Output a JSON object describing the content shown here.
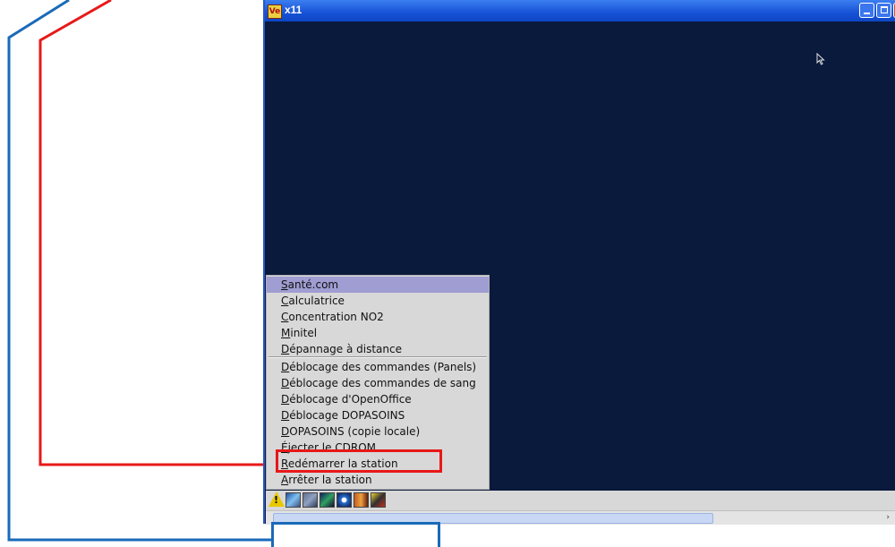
{
  "window": {
    "title": "x11",
    "app_icon_label": "Ve",
    "background_color": "#0a1a3c"
  },
  "menu": {
    "items": [
      {
        "prefix": "",
        "mnemonic": "S",
        "rest": "anté.com",
        "active": true
      },
      {
        "prefix": "",
        "mnemonic": "C",
        "rest": "alculatrice"
      },
      {
        "prefix": "",
        "mnemonic": "C",
        "rest": "oncentration NO2"
      },
      {
        "prefix": "",
        "mnemonic": "M",
        "rest": "initel"
      },
      {
        "prefix": "",
        "mnemonic": "D",
        "rest": "épannage à distance"
      },
      {
        "prefix": "",
        "mnemonic": "D",
        "rest": "éblocage des commandes (Panels)"
      },
      {
        "prefix": "",
        "mnemonic": "D",
        "rest": "éblocage des commandes de sang"
      },
      {
        "prefix": "",
        "mnemonic": "D",
        "rest": "éblocage d'OpenOffice"
      },
      {
        "prefix": "",
        "mnemonic": "D",
        "rest": "éblocage DOPASOINS"
      },
      {
        "prefix": "",
        "mnemonic": "D",
        "rest": "OPASOINS (copie locale)"
      },
      {
        "prefix": "",
        "mnemonic": "É",
        "rest": "jecter le CDROM"
      },
      {
        "prefix": "",
        "mnemonic": "R",
        "rest": "edémarrer la station"
      },
      {
        "prefix": "",
        "mnemonic": "A",
        "rest": "rrêter la station"
      }
    ]
  },
  "taskbar": {
    "warning_symbol": "!",
    "icons": [
      "warning-icon",
      "app-icon-1",
      "app-icon-2",
      "app-icon-3",
      "app-icon-4",
      "app-icon-5",
      "app-icon-6"
    ]
  },
  "scrollbar": {
    "right_arrow": "›"
  },
  "colors": {
    "menu_highlight": "#9f9dd2",
    "annotation_red": "#e81818",
    "annotation_blue": "#1a6ab8"
  }
}
